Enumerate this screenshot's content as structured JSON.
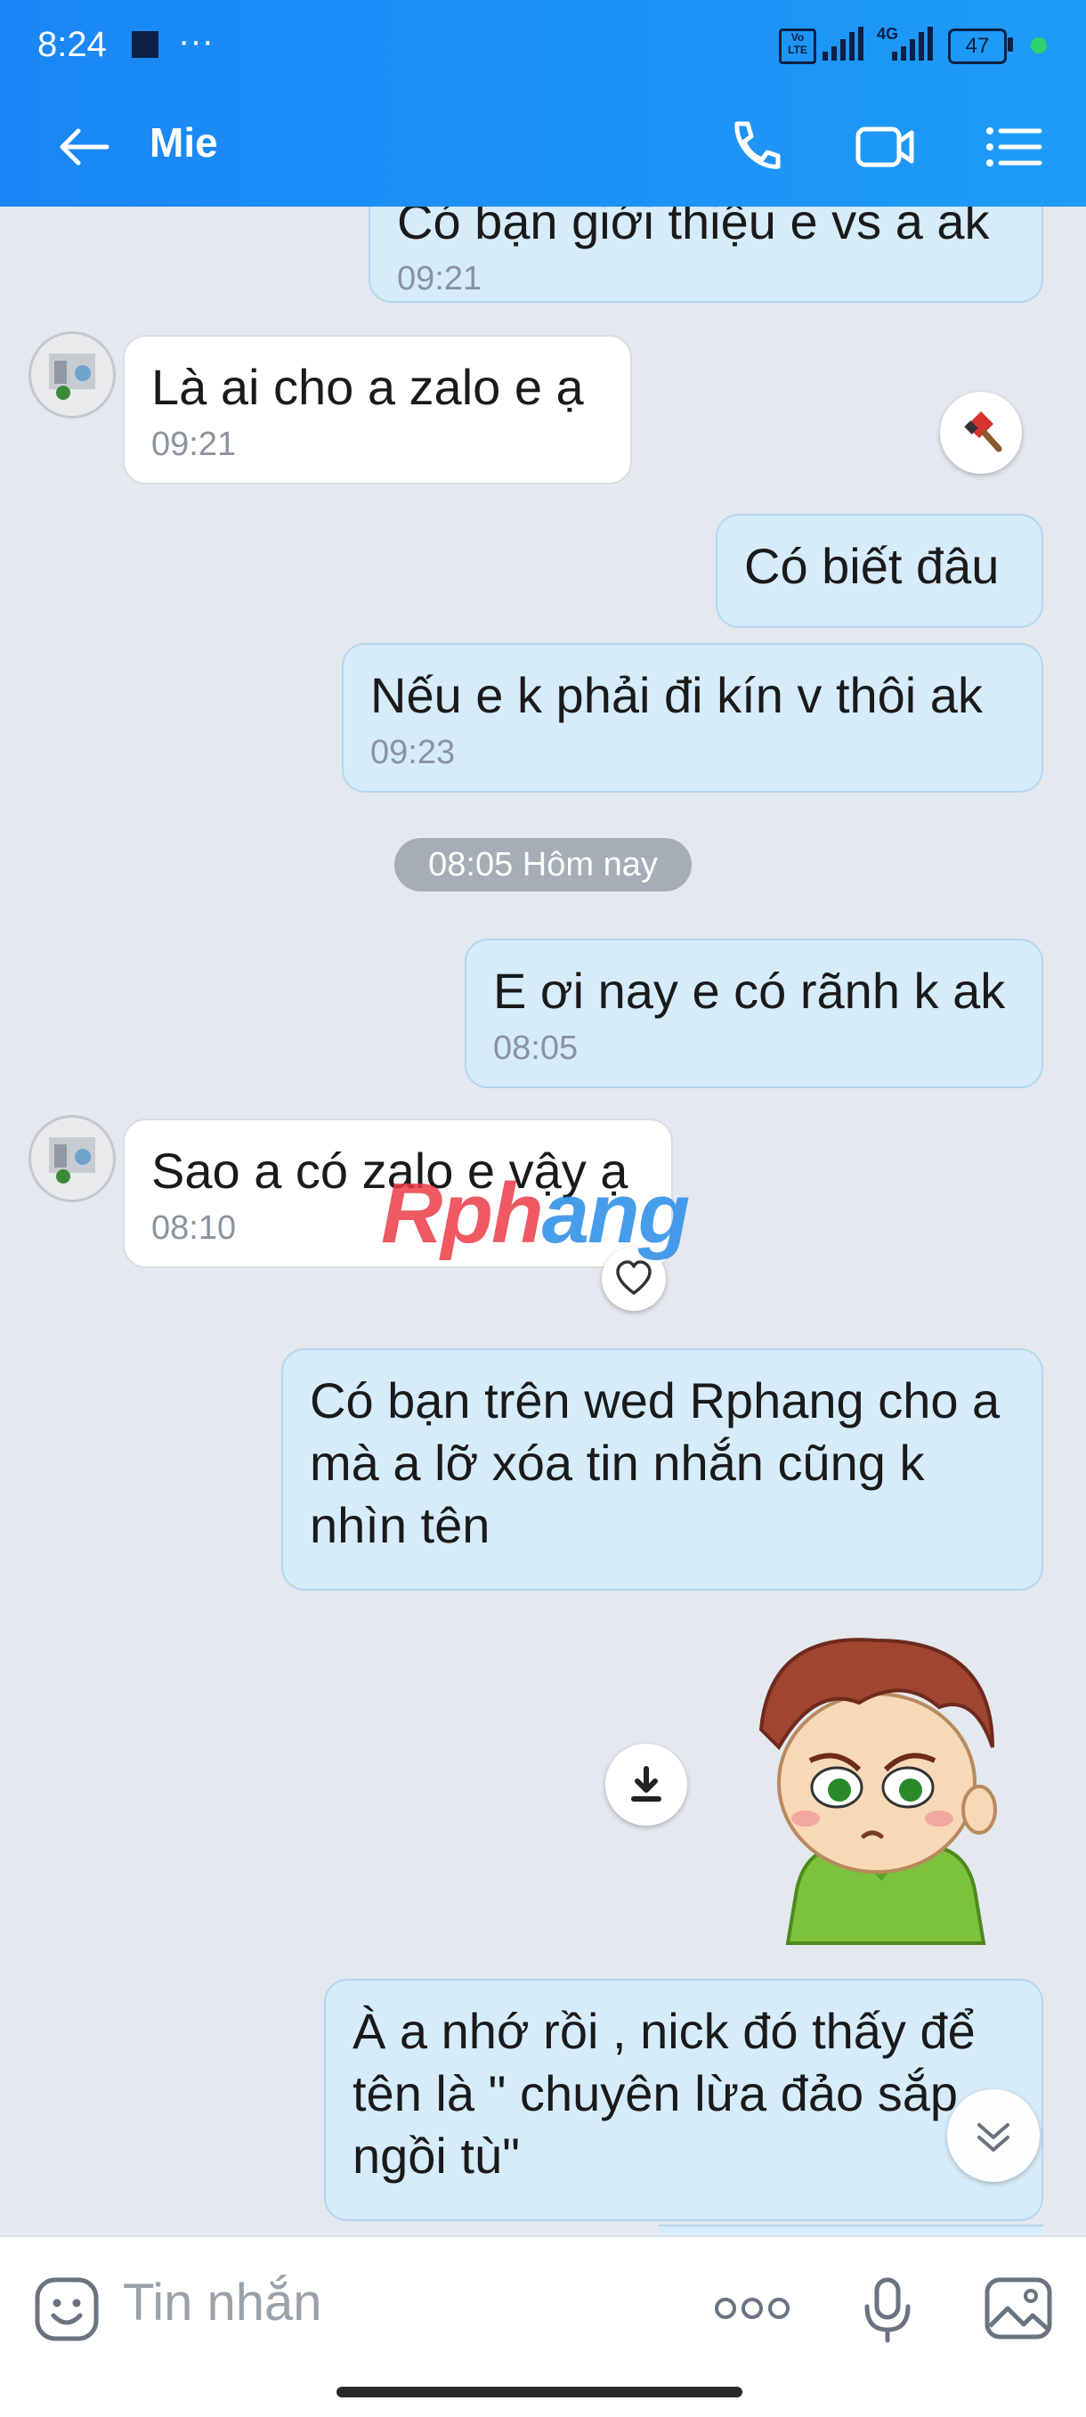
{
  "status_bar": {
    "time": "8:24",
    "dots": "···",
    "network_badge": "Vo LTE",
    "network_type": "4G",
    "battery": "47"
  },
  "header": {
    "contact_name": "Mie"
  },
  "messages": [
    {
      "sender": "me",
      "text": "Có bạn giới thiệu e vs a ak",
      "time": "09:21"
    },
    {
      "sender": "them",
      "text": "Là ai cho a zalo e ạ",
      "time": "09:21"
    },
    {
      "sender": "me",
      "text": "Có biết đâu",
      "time": ""
    },
    {
      "sender": "me",
      "text": "Nếu e k phải đi kín v thôi ak",
      "time": "09:23"
    },
    {
      "sender": "me",
      "text": "E ơi nay e có rãnh k ak",
      "time": "08:05"
    },
    {
      "sender": "them",
      "text": "Sao a có zalo e vậy ạ",
      "time": "08:10"
    },
    {
      "sender": "me",
      "text": "Có bạn trên wed Rphang cho a mà a lỡ xóa tin nhắn cũng k nhìn tên",
      "time": ""
    },
    {
      "sender": "me",
      "text": "À a nhớ rồi , nick đó thấy để tên là \" chuyên lừa đảo sắp ngồi tù\"",
      "time": ""
    }
  ],
  "date_separator": "08:05 Hôm nay",
  "watermark": {
    "part1": "Rph",
    "part2": "ang"
  },
  "composer": {
    "placeholder": "Tin nhắn"
  },
  "colors": {
    "header": "#1a86f5",
    "my_bubble": "#d6ecfb",
    "their_bubble": "#ffffff",
    "chat_bg": "#e4e8ef"
  },
  "icons": [
    "back-arrow-icon",
    "phone-icon",
    "video-call-icon",
    "menu-list-icon",
    "hammer-reaction-icon",
    "heart-icon",
    "download-icon",
    "scroll-down-icon",
    "emoji-icon",
    "more-icon",
    "microphone-icon",
    "gallery-icon"
  ]
}
